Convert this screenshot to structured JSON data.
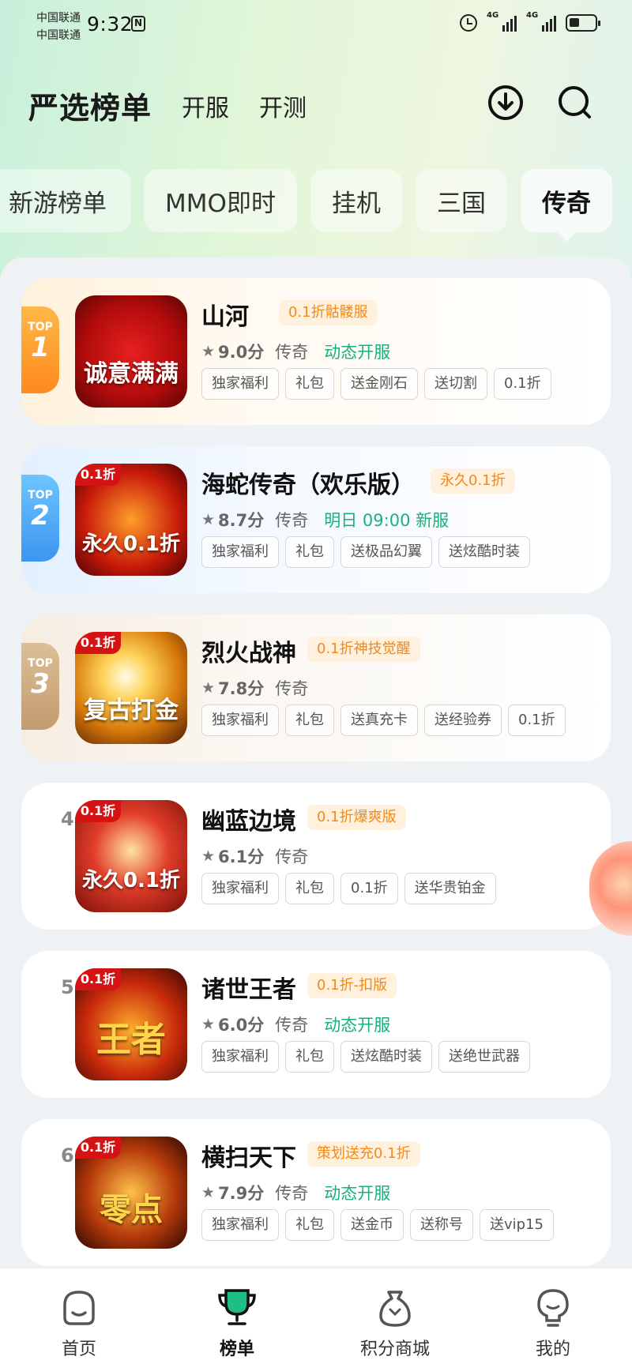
{
  "status_bar": {
    "carrier_1": "中国联通",
    "carrier_2": "中国联通",
    "time": "9:32",
    "nfc_label": "N",
    "signal_1": "4G",
    "signal_2": "4G"
  },
  "header": {
    "title": "严选榜单",
    "links": [
      "开服",
      "开测"
    ],
    "download_icon": "download-icon",
    "search_icon": "search-icon"
  },
  "category_tabs": [
    {
      "label": "新游榜单",
      "active": false
    },
    {
      "label": "MMO即时",
      "active": false
    },
    {
      "label": "挂机",
      "active": false
    },
    {
      "label": "三国",
      "active": false
    },
    {
      "label": "传奇",
      "active": true
    }
  ],
  "games": [
    {
      "rank": "1",
      "rank_prefix": "TOP",
      "icon_text": "诚意满满",
      "icon_corner": "",
      "name": "山河",
      "promo": "0.1折骷髅服",
      "score": "9.0分",
      "genre": "传奇",
      "server": "动态开服",
      "tags": [
        "独家福利",
        "礼包",
        "送金刚石",
        "送切割",
        "0.1折"
      ]
    },
    {
      "rank": "2",
      "rank_prefix": "TOP",
      "icon_text": "永久0.1折",
      "icon_corner": "0.1折",
      "name": "海蛇传奇（欢乐版）",
      "promo": "永久0.1折",
      "score": "8.7分",
      "genre": "传奇",
      "server": "明日 09:00 新服",
      "tags": [
        "独家福利",
        "礼包",
        "送极品幻翼",
        "送炫酷时装"
      ]
    },
    {
      "rank": "3",
      "rank_prefix": "TOP",
      "icon_text": "复古打金",
      "icon_corner": "0.1折",
      "name": "烈火战神",
      "promo": "0.1折神技觉醒",
      "score": "7.8分",
      "genre": "传奇",
      "server": "",
      "tags": [
        "独家福利",
        "礼包",
        "送真充卡",
        "送经验券",
        "0.1折"
      ]
    },
    {
      "rank": "4",
      "rank_prefix": "",
      "icon_text": "永久0.1折",
      "icon_corner": "0.1折",
      "name": "幽蓝边境",
      "promo": "0.1折爆爽版",
      "score": "6.1分",
      "genre": "传奇",
      "server": "",
      "tags": [
        "独家福利",
        "礼包",
        "0.1折",
        "送华贵铂金"
      ]
    },
    {
      "rank": "5",
      "rank_prefix": "",
      "icon_text": "王者",
      "icon_corner": "0.1折",
      "name": "诸世王者",
      "promo": "0.1折-扣版",
      "score": "6.0分",
      "genre": "传奇",
      "server": "动态开服",
      "tags": [
        "独家福利",
        "礼包",
        "送炫酷时装",
        "送绝世武器"
      ]
    },
    {
      "rank": "6",
      "rank_prefix": "",
      "icon_text": "零点",
      "icon_corner": "0.1折",
      "name": "横扫天下",
      "promo": "策划送充0.1折",
      "score": "7.9分",
      "genre": "传奇",
      "server": "动态开服",
      "tags": [
        "独家福利",
        "礼包",
        "送金币",
        "送称号",
        "送vip15"
      ]
    }
  ],
  "bottom_nav": [
    {
      "label": "首页",
      "icon": "home-face-icon",
      "active": false
    },
    {
      "label": "榜单",
      "icon": "trophy-icon",
      "active": true
    },
    {
      "label": "积分商城",
      "icon": "money-bag-icon",
      "active": false
    },
    {
      "label": "我的",
      "icon": "profile-bulb-icon",
      "active": false
    }
  ],
  "colors": {
    "accent_green": "#19b07b",
    "promo_orange": "#f18a1a",
    "rank1": "#ff8a1e",
    "rank2": "#3c95f0",
    "rank3": "#c39b6e"
  }
}
